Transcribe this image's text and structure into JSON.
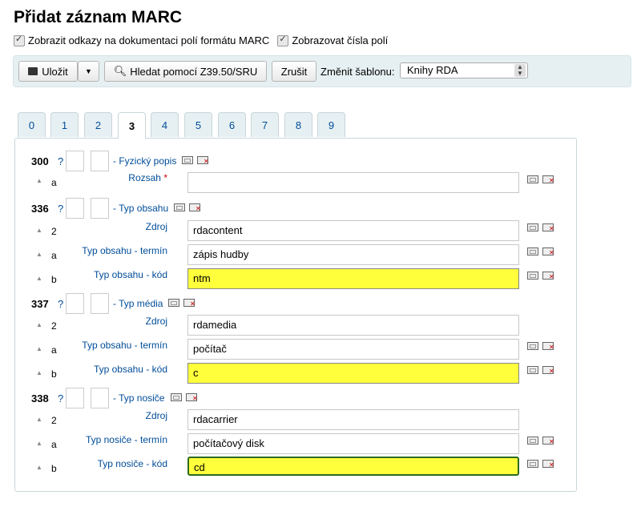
{
  "title": "Přidat záznam MARC",
  "options": {
    "show_docs": "Zobrazit odkazy na dokumentaci polí formátu MARC",
    "show_numbers": "Zobrazovat čísla polí"
  },
  "toolbar": {
    "save": "Uložit",
    "z3950": "Hledat pomocí Z39.50/SRU",
    "cancel": "Zrušit",
    "template_label": "Změnit šablonu:",
    "template_value": "Knihy RDA"
  },
  "tabs": [
    "0",
    "1",
    "2",
    "3",
    "4",
    "5",
    "6",
    "7",
    "8",
    "9"
  ],
  "active_tab": "3",
  "fields": {
    "f300": {
      "tag": "300",
      "q": "?",
      "name": "- Fyzický popis",
      "sub_a": {
        "code": "a",
        "label": "Rozsah",
        "required": "*",
        "value": ""
      }
    },
    "f336": {
      "tag": "336",
      "q": "?",
      "name": "- Typ obsahu",
      "sub_2": {
        "code": "2",
        "label": "Zdroj",
        "value": "rdacontent"
      },
      "sub_a": {
        "code": "a",
        "label": "Typ obsahu - termín",
        "value": "zápis hudby"
      },
      "sub_b": {
        "code": "b",
        "label": "Typ obsahu - kód",
        "value": "ntm"
      }
    },
    "f337": {
      "tag": "337",
      "q": "?",
      "name": "- Typ média",
      "sub_2": {
        "code": "2",
        "label": "Zdroj",
        "value": "rdamedia"
      },
      "sub_a": {
        "code": "a",
        "label": "Typ obsahu - termín",
        "value": "počítač"
      },
      "sub_b": {
        "code": "b",
        "label": "Typ obsahu - kód",
        "value": "c"
      }
    },
    "f338": {
      "tag": "338",
      "q": "?",
      "name": "- Typ nosiče",
      "sub_2": {
        "code": "2",
        "label": "Zdroj",
        "value": "rdacarrier"
      },
      "sub_a": {
        "code": "a",
        "label": "Typ nosiče - termín",
        "value": "počítačový disk"
      },
      "sub_b": {
        "code": "b",
        "label": "Typ nosiče - kód",
        "value": "cd"
      }
    }
  },
  "colors": {
    "link": "#004d99",
    "highlight": "#ffff3c",
    "toolbar_bg": "#e6f0f2"
  }
}
